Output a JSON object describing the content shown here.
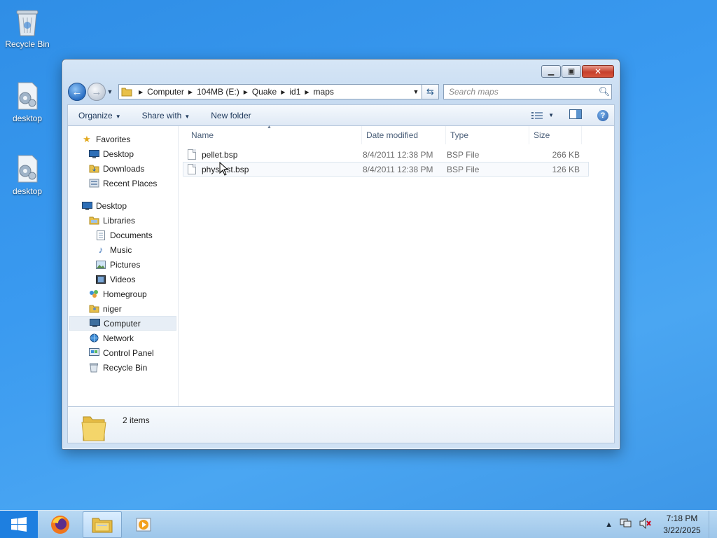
{
  "desktop": {
    "icons": [
      {
        "label": "Recycle Bin"
      },
      {
        "label": "desktop"
      },
      {
        "label": "desktop"
      }
    ]
  },
  "window": {
    "address": {
      "crumbs": [
        "Computer",
        "104MB (E:)",
        "Quake",
        "id1",
        "maps"
      ]
    },
    "search": {
      "placeholder": "Search maps"
    },
    "toolbar": {
      "organize": "Organize",
      "share_with": "Share with",
      "new_folder": "New folder"
    },
    "nav": {
      "favorites": "Favorites",
      "fav_items": [
        "Desktop",
        "Downloads",
        "Recent Places"
      ],
      "desktop": "Desktop",
      "libraries": "Libraries",
      "lib_items": [
        "Documents",
        "Music",
        "Pictures",
        "Videos"
      ],
      "homegroup": "Homegroup",
      "user": "niger",
      "computer": "Computer",
      "network": "Network",
      "control_panel": "Control Panel",
      "recycle_bin": "Recycle Bin"
    },
    "columns": {
      "name": "Name",
      "date": "Date modified",
      "type": "Type",
      "size": "Size"
    },
    "files": [
      {
        "name": "pellet.bsp",
        "date": "8/4/2011 12:38 PM",
        "type": "BSP File",
        "size": "266 KB"
      },
      {
        "name": "phystest.bsp",
        "date": "8/4/2011 12:38 PM",
        "type": "BSP File",
        "size": "126 KB"
      }
    ],
    "details": {
      "count": "2 items"
    }
  },
  "taskbar": {
    "time": "7:18 PM",
    "date": "3/22/2025"
  },
  "colors": {
    "desktop_bg": "#3a9af0",
    "start": "#1e7fe0",
    "close": "#c6402c"
  }
}
